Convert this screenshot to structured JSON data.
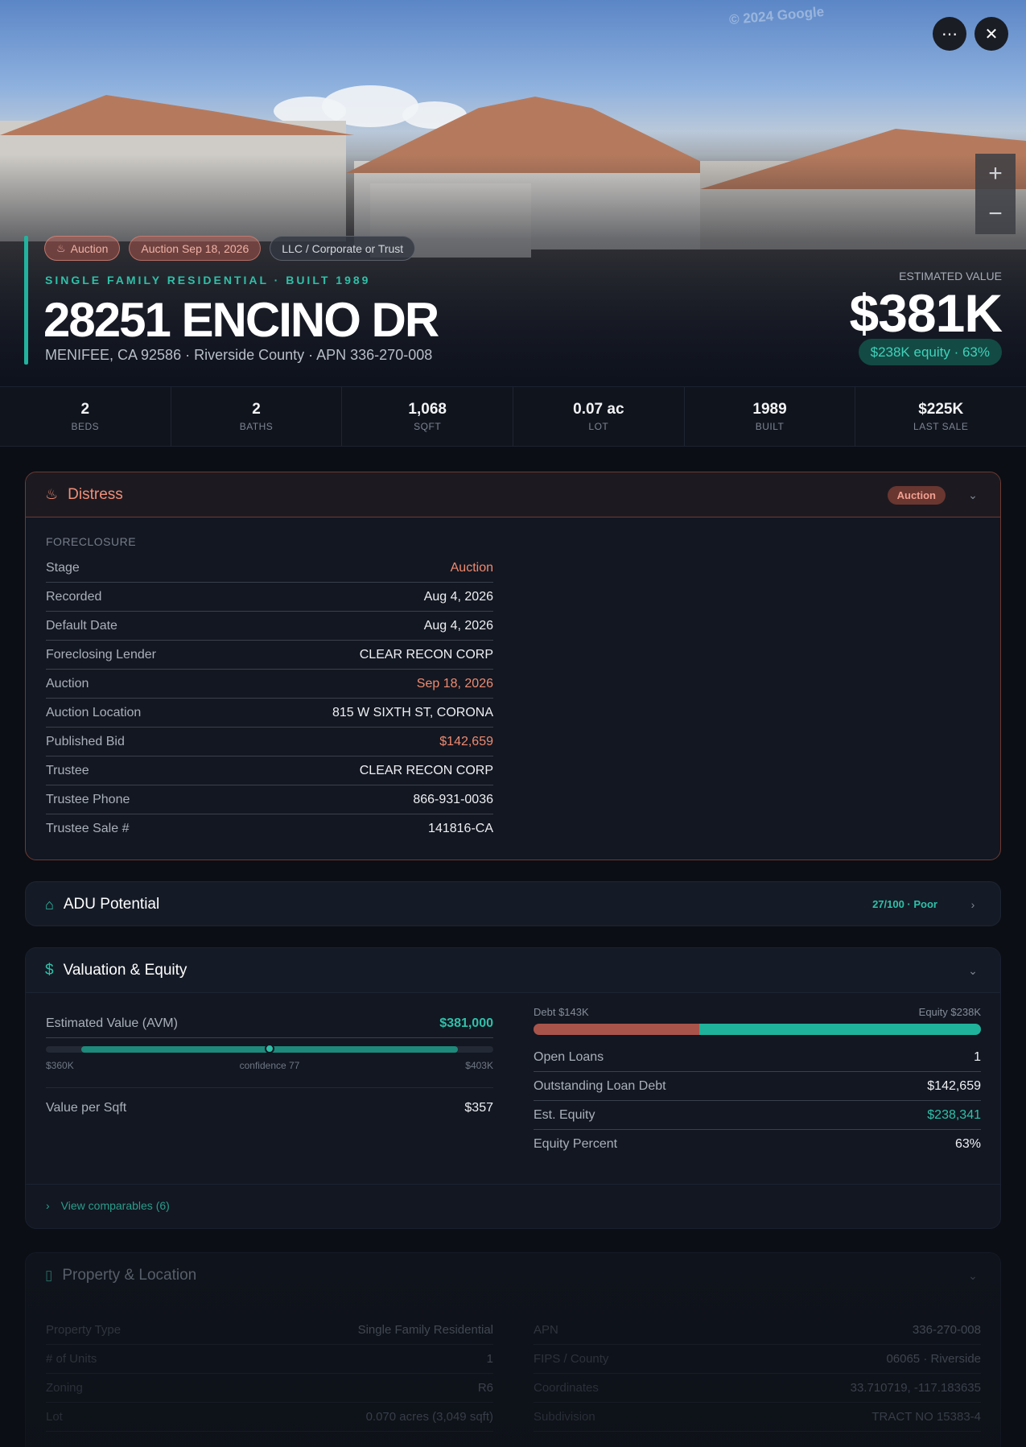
{
  "hero": {
    "watermark": "© 2024 Google",
    "more_icon": "ellipsis-icon",
    "close_icon": "close-icon",
    "zoom_in": "+",
    "zoom_out": "−",
    "chips": [
      {
        "label": "Auction",
        "icon": "flame-icon"
      },
      {
        "label": "Auction Sep 18, 2026"
      },
      {
        "label": "LLC / Corporate or Trust"
      }
    ],
    "subtitle": "SINGLE FAMILY RESIDENTIAL · BUILT 1989",
    "address": "28251 ENCINO DR",
    "address_sub": "MENIFEE, CA 92586 · Riverside County · APN 336-270-008",
    "estimated_label": "ESTIMATED VALUE",
    "estimated_value": "$381K",
    "equity_pill": "$238K equity · 63%"
  },
  "stats": [
    {
      "value": "2",
      "label": "BEDS"
    },
    {
      "value": "2",
      "label": "BATHS"
    },
    {
      "value": "1,068",
      "label": "SQFT"
    },
    {
      "value": "0.07 ac",
      "label": "LOT"
    },
    {
      "value": "1989",
      "label": "BUILT"
    },
    {
      "value": "$225K",
      "label": "LAST SALE"
    }
  ],
  "distress": {
    "title": "Distress",
    "badge": "Auction",
    "section_label": "FORECLOSURE",
    "rows": [
      {
        "k": "Stage",
        "v": "Auction"
      },
      {
        "k": "Recorded",
        "v": "Aug 4, 2026"
      },
      {
        "k": "Default Date",
        "v": "Aug 4, 2026"
      },
      {
        "k": "Foreclosing Lender",
        "v": "CLEAR RECON CORP"
      },
      {
        "k": "Auction",
        "v": "Sep 18, 2026"
      },
      {
        "k": "Auction Location",
        "v": "815 W SIXTH ST, CORONA"
      },
      {
        "k": "Published Bid",
        "v": "$142,659"
      },
      {
        "k": "Trustee",
        "v": "CLEAR RECON CORP"
      },
      {
        "k": "Trustee Phone",
        "v": "866-931-0036"
      },
      {
        "k": "Trustee Sale #",
        "v": "141816-CA"
      }
    ]
  },
  "adu": {
    "title": "ADU Potential",
    "score": "27/100 · Poor"
  },
  "valuation": {
    "title": "Valuation & Equity",
    "avm_label": "Estimated Value (AVM)",
    "avm_value": "$381,000",
    "range_low": "$360K",
    "confidence": "confidence 77",
    "range_high": "$403K",
    "vps_label": "Value per Sqft",
    "vps_value": "$357",
    "debt_label": "Debt $143K",
    "equity_label": "Equity $238K",
    "equity_fraction": 0.63,
    "rows": [
      {
        "k": "Open Loans",
        "v": "1"
      },
      {
        "k": "Outstanding Loan Debt",
        "v": "$142,659"
      },
      {
        "k": "Est. Equity",
        "v": "$238,341"
      },
      {
        "k": "Equity Percent",
        "v": "63%"
      }
    ],
    "comps": "View comparables (6)"
  },
  "property": {
    "title": "Property & Location",
    "left": [
      {
        "k": "Property Type",
        "v": "Single Family Residential"
      },
      {
        "k": "# of Units",
        "v": "1"
      },
      {
        "k": "Zoning",
        "v": "R6"
      },
      {
        "k": "Lot",
        "v": "0.070 acres (3,049 sqft)"
      }
    ],
    "right": [
      {
        "k": "APN",
        "v": "336-270-008"
      },
      {
        "k": "FIPS / County",
        "v": "06065 · Riverside"
      },
      {
        "k": "Coordinates",
        "v": "33.710719, -117.183635"
      },
      {
        "k": "Subdivision",
        "v": "TRACT NO 15383-4"
      }
    ]
  },
  "colors": {
    "accent": "#22b39f",
    "distress": "#ef8a70",
    "debt": "#a9544a",
    "equity": "#1fb39c"
  }
}
